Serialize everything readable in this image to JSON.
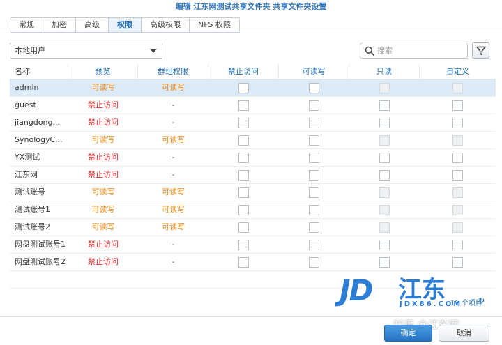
{
  "window": {
    "title": "编辑 江东网测试共享文件夹 共享文件夹设置"
  },
  "tabs": [
    {
      "label": "常规",
      "active": false
    },
    {
      "label": "加密",
      "active": false
    },
    {
      "label": "高级",
      "active": false
    },
    {
      "label": "权限",
      "active": true
    },
    {
      "label": "高级权限",
      "active": false
    },
    {
      "label": "NFS 权限",
      "active": false
    }
  ],
  "toolbar": {
    "user_type": "本地用户",
    "search_placeholder": "搜索",
    "search_icon": "search-icon",
    "filter_icon": "filter-icon"
  },
  "table": {
    "columns": [
      "名称",
      "预览",
      "群组权限",
      "禁止访问",
      "可读写",
      "只读",
      "自定义"
    ],
    "rows": [
      {
        "name": "admin",
        "preview": "可读写",
        "preview_color": "orange",
        "group": "可读写",
        "group_color": "orange",
        "selected": true,
        "readonly_disabled": true,
        "custom_disabled": true
      },
      {
        "name": "guest",
        "preview": "禁止访问",
        "preview_color": "red",
        "group": "-",
        "group_color": "dash",
        "selected": false,
        "readonly_disabled": false,
        "custom_disabled": false
      },
      {
        "name": "jiangdong...",
        "preview": "禁止访问",
        "preview_color": "red",
        "group": "-",
        "group_color": "dash",
        "selected": false,
        "readonly_disabled": false,
        "custom_disabled": false
      },
      {
        "name": "SynologyC...",
        "preview": "可读写",
        "preview_color": "orange",
        "group": "可读写",
        "group_color": "orange",
        "selected": false,
        "readonly_disabled": true,
        "custom_disabled": true
      },
      {
        "name": "YX测试",
        "preview": "禁止访问",
        "preview_color": "red",
        "group": "-",
        "group_color": "dash",
        "selected": false,
        "readonly_disabled": false,
        "custom_disabled": false
      },
      {
        "name": "江东网",
        "preview": "禁止访问",
        "preview_color": "red",
        "group": "-",
        "group_color": "dash",
        "selected": false,
        "readonly_disabled": false,
        "custom_disabled": false
      },
      {
        "name": "测试账号",
        "preview": "可读写",
        "preview_color": "orange",
        "group": "可读写",
        "group_color": "orange",
        "selected": false,
        "readonly_disabled": true,
        "custom_disabled": true
      },
      {
        "name": "测试账号1",
        "preview": "可读写",
        "preview_color": "orange",
        "group": "可读写",
        "group_color": "orange",
        "selected": false,
        "readonly_disabled": true,
        "custom_disabled": true
      },
      {
        "name": "测试账号2",
        "preview": "可读写",
        "preview_color": "orange",
        "group": "可读写",
        "group_color": "orange",
        "selected": false,
        "readonly_disabled": true,
        "custom_disabled": true
      },
      {
        "name": "网盘测试账号1",
        "preview": "禁止访问",
        "preview_color": "red",
        "group": "-",
        "group_color": "dash",
        "selected": false,
        "readonly_disabled": false,
        "custom_disabled": false
      },
      {
        "name": "网盘测试账号2",
        "preview": "禁止访问",
        "preview_color": "red",
        "group": "-",
        "group_color": "dash",
        "selected": false,
        "readonly_disabled": false,
        "custom_disabled": false
      }
    ]
  },
  "status": {
    "item_count": "11 个项目",
    "refresh_icon": "refresh-icon"
  },
  "watermark": {
    "logo": "JD江东",
    "url": "JDX86.COM",
    "credit": "知乎 @江东网"
  },
  "buttons": {
    "ok": "确定",
    "cancel": "取消"
  },
  "colors": {
    "accent": "#1e6fb8",
    "orange": "#f08a10",
    "red": "#e03030",
    "selected_row": "#dce9f6"
  }
}
